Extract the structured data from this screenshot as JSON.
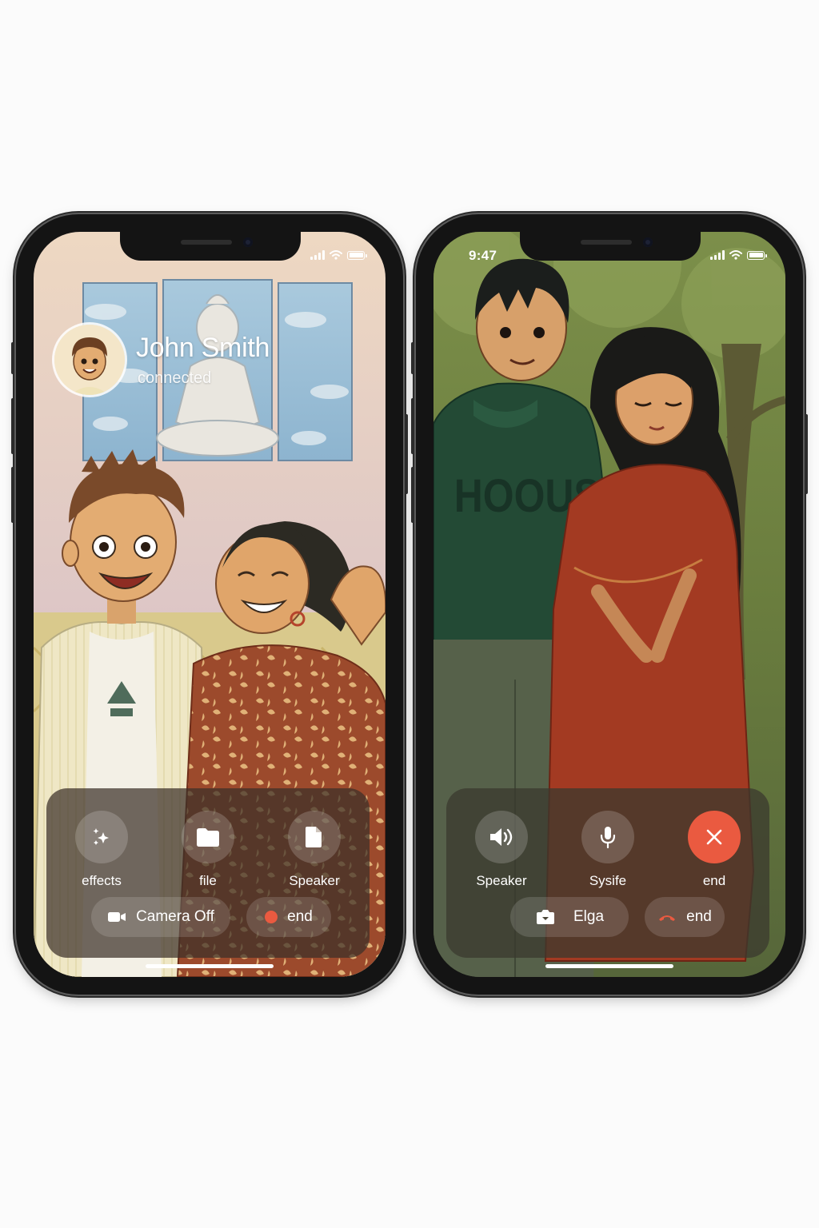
{
  "left_phone": {
    "status": {
      "signal": "signal-icon",
      "wifi": "wifi-icon",
      "battery": "battery-icon"
    },
    "caller": {
      "name": "John Smith",
      "status": "connected",
      "avatar": "caller-avatar"
    },
    "controls": [
      {
        "label": "effects",
        "icon": "sparkles-icon"
      },
      {
        "label": "file",
        "icon": "folder-icon"
      },
      {
        "label": "Speaker",
        "icon": "document-icon"
      }
    ],
    "pills": [
      {
        "label": "Camera Off",
        "icon": "video-camera-icon"
      },
      {
        "label": "end",
        "icon": "record-dot-icon",
        "color": "#ea5a40"
      }
    ]
  },
  "right_phone": {
    "status": {
      "time": "9:47",
      "signal": "signal-icon",
      "wifi": "wifi-icon",
      "battery": "battery-icon"
    },
    "controls": [
      {
        "label": "Speaker",
        "icon": "speaker-icon"
      },
      {
        "label": "Sysife",
        "icon": "microphone-icon"
      },
      {
        "label": "end",
        "icon": "close-icon",
        "color": "#ea5a40"
      }
    ],
    "pills": [
      {
        "label": "Elga",
        "icon": "camera-flip-icon"
      },
      {
        "label": "end",
        "icon": "hang-up-icon",
        "color": "#ea5a40"
      }
    ]
  }
}
